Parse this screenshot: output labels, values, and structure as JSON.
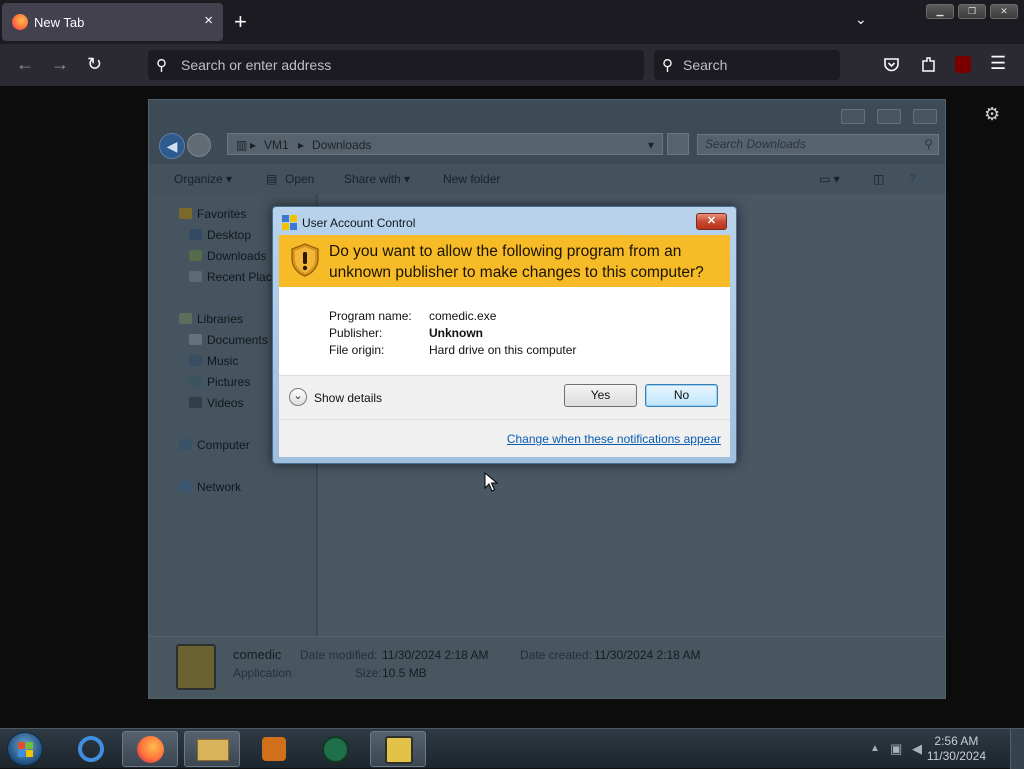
{
  "browser": {
    "tab_title": "New Tab",
    "tab_close": "×",
    "new_tab": "+",
    "tab_list": "⌄",
    "url_placeholder": "Search or enter address",
    "search_placeholder": "Search",
    "icons": [
      "back-icon",
      "forward-icon",
      "reload-icon",
      "pocket-icon",
      "extensions-icon",
      "ublock-icon",
      "menu-icon",
      "gear-icon"
    ]
  },
  "explorer": {
    "path": [
      "VM1",
      "Downloads"
    ],
    "search_placeholder": "Search Downloads",
    "commands": {
      "organize": "Organize ▾",
      "open": "Open",
      "share": "Share with ▾",
      "new_folder": "New folder"
    },
    "nav": {
      "favorites": "Favorites",
      "desktop": "Desktop",
      "downloads": "Downloads",
      "recent": "Recent Places",
      "libraries": "Libraries",
      "documents": "Documents",
      "music": "Music",
      "pictures": "Pictures",
      "videos": "Videos",
      "computer": "Computer",
      "network": "Network"
    },
    "details": {
      "name": "comedic",
      "type": "Application",
      "modified_label": "Date modified:",
      "modified": "11/30/2024 2:18 AM",
      "created_label": "Date created:",
      "created": "11/30/2024 2:18 AM",
      "size_label": "Size:",
      "size": "10.5 MB"
    }
  },
  "uac": {
    "title": "User Account Control",
    "close": "✕",
    "question": "Do you want to allow the following program from an unknown publisher to make changes to this computer?",
    "program_label": "Program name:",
    "program_value": "comedic.exe",
    "publisher_label": "Publisher:",
    "publisher_value": "Unknown",
    "origin_label": "File origin:",
    "origin_value": "Hard drive on this computer",
    "show_details": "Show details",
    "yes": "Yes",
    "no": "No",
    "link": "Change when these notifications appear",
    "colors": {
      "banner": "#f7bb28",
      "link": "#0b5cb0"
    }
  },
  "taskbar": {
    "time": "2:56 AM",
    "date": "11/30/2024",
    "apps": [
      "internet-explorer-icon",
      "firefox-icon",
      "file-explorer-icon",
      "media-player-icon",
      "network-app-icon",
      "comedic-app-icon"
    ]
  }
}
